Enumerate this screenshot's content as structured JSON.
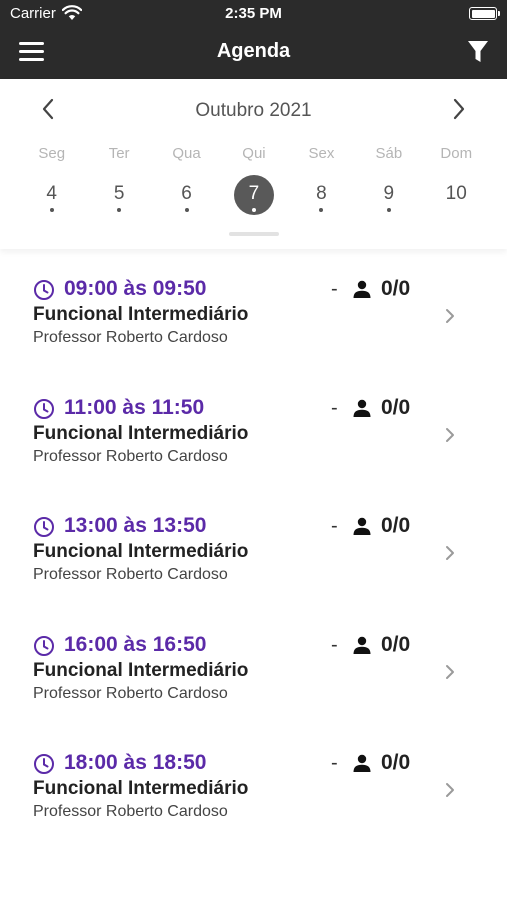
{
  "status_bar": {
    "carrier": "Carrier",
    "time": "2:35 PM"
  },
  "nav": {
    "title": "Agenda",
    "menu_icon": "hamburger-icon",
    "filter_icon": "filter-icon"
  },
  "calendar": {
    "month": "Outubro 2021",
    "days": [
      {
        "weekday": "Seg",
        "number": "4",
        "has_events": true,
        "selected": false
      },
      {
        "weekday": "Ter",
        "number": "5",
        "has_events": true,
        "selected": false
      },
      {
        "weekday": "Qua",
        "number": "6",
        "has_events": true,
        "selected": false
      },
      {
        "weekday": "Qui",
        "number": "7",
        "has_events": true,
        "selected": true
      },
      {
        "weekday": "Sex",
        "number": "8",
        "has_events": true,
        "selected": false
      },
      {
        "weekday": "Sáb",
        "number": "9",
        "has_events": true,
        "selected": false
      },
      {
        "weekday": "Dom",
        "number": "10",
        "has_events": false,
        "selected": false
      }
    ]
  },
  "classes": [
    {
      "time": "09:00 às 09:50",
      "separator": "-",
      "spots": "0/0",
      "name": "Funcional Intermediário",
      "teacher": "Professor Roberto Cardoso"
    },
    {
      "time": "11:00 às 11:50",
      "separator": "-",
      "spots": "0/0",
      "name": "Funcional Intermediário",
      "teacher": "Professor Roberto Cardoso"
    },
    {
      "time": "13:00 às 13:50",
      "separator": "-",
      "spots": "0/0",
      "name": "Funcional Intermediário",
      "teacher": "Professor Roberto Cardoso"
    },
    {
      "time": "16:00 às 16:50",
      "separator": "-",
      "spots": "0/0",
      "name": "Funcional Intermediário",
      "teacher": "Professor Roberto Cardoso"
    },
    {
      "time": "18:00 às 18:50",
      "separator": "-",
      "spots": "0/0",
      "name": "Funcional Intermediário",
      "teacher": "Professor Roberto Cardoso"
    }
  ],
  "colors": {
    "accent": "#5b2aa8",
    "header": "#2b2b2b",
    "selected_day": "#595959"
  }
}
